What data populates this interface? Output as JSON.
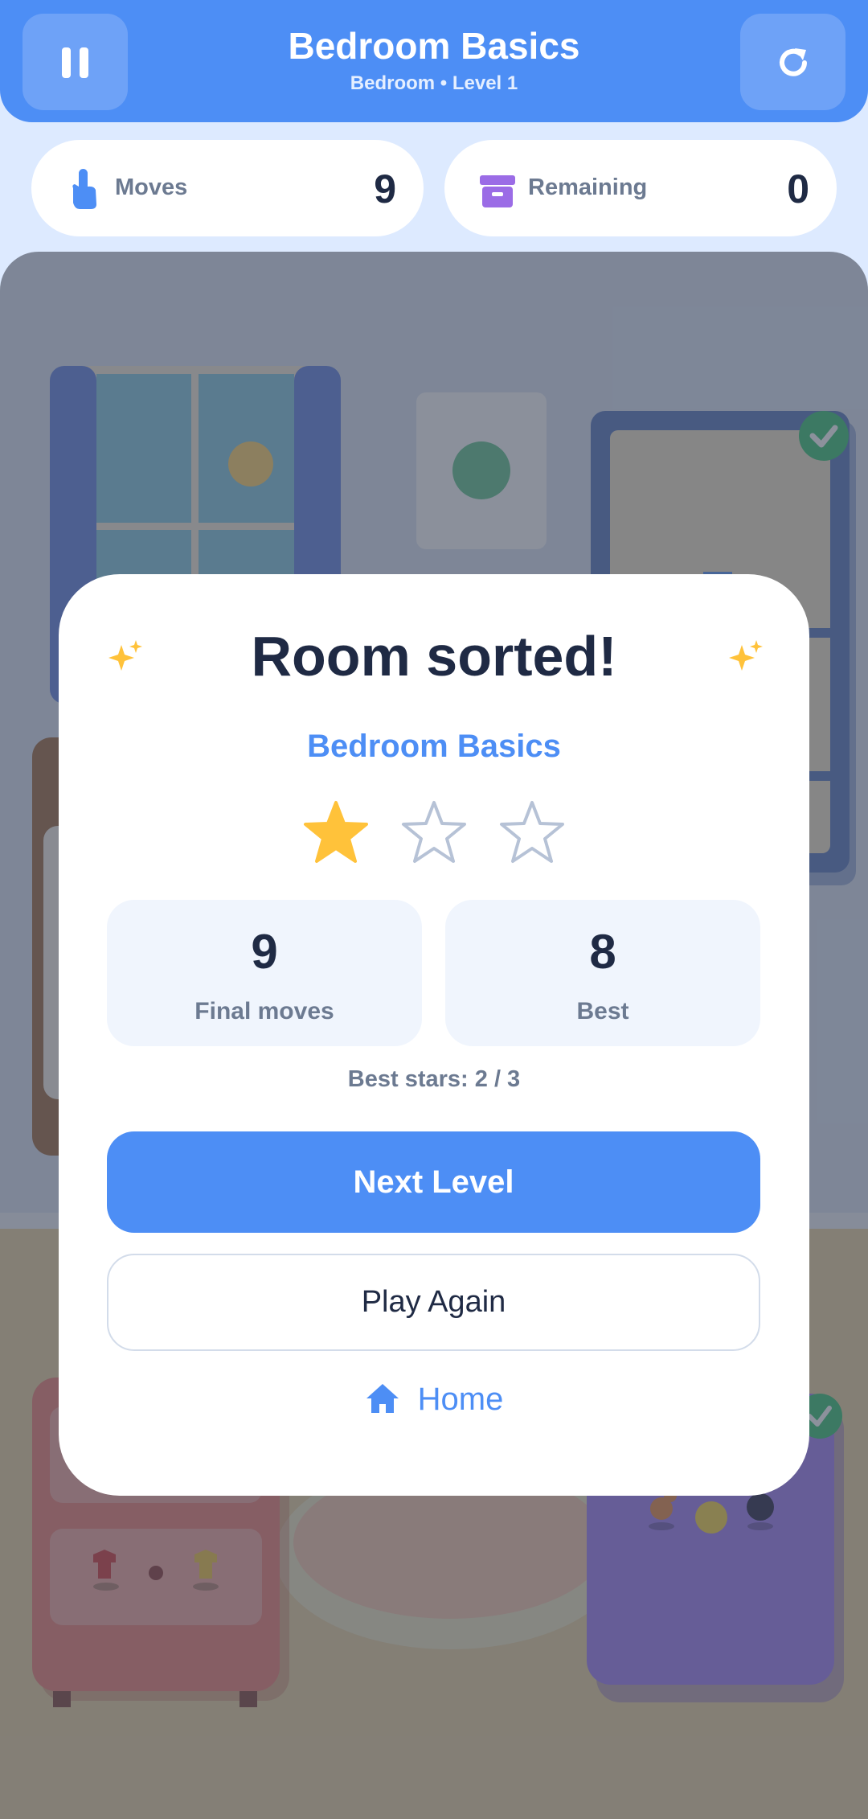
{
  "header": {
    "title": "Bedroom Basics",
    "subtitle": "Bedroom • Level 1",
    "pause_icon": "pause-icon",
    "restart_icon": "restart-icon"
  },
  "stats": {
    "moves": {
      "label": "Moves",
      "value": "9",
      "icon": "tap-hand-icon"
    },
    "remaining": {
      "label": "Remaining",
      "value": "0",
      "icon": "storage-box-icon"
    }
  },
  "modal": {
    "title": "Room sorted!",
    "level_name": "Bedroom Basics",
    "stars_earned": 1,
    "stars_total": 3,
    "final_moves": {
      "value": "9",
      "label": "Final moves"
    },
    "best": {
      "value": "8",
      "label": "Best"
    },
    "best_stars": "Best stars: 2 / 3",
    "next_button": "Next Level",
    "again_button": "Play Again",
    "home_button": "Home"
  },
  "colors": {
    "accent": "#4d8ef5",
    "star_filled": "#ffc23a",
    "star_empty": "#b6c2d6",
    "text_dark": "#1f2a44",
    "text_muted": "#6c7a91"
  }
}
